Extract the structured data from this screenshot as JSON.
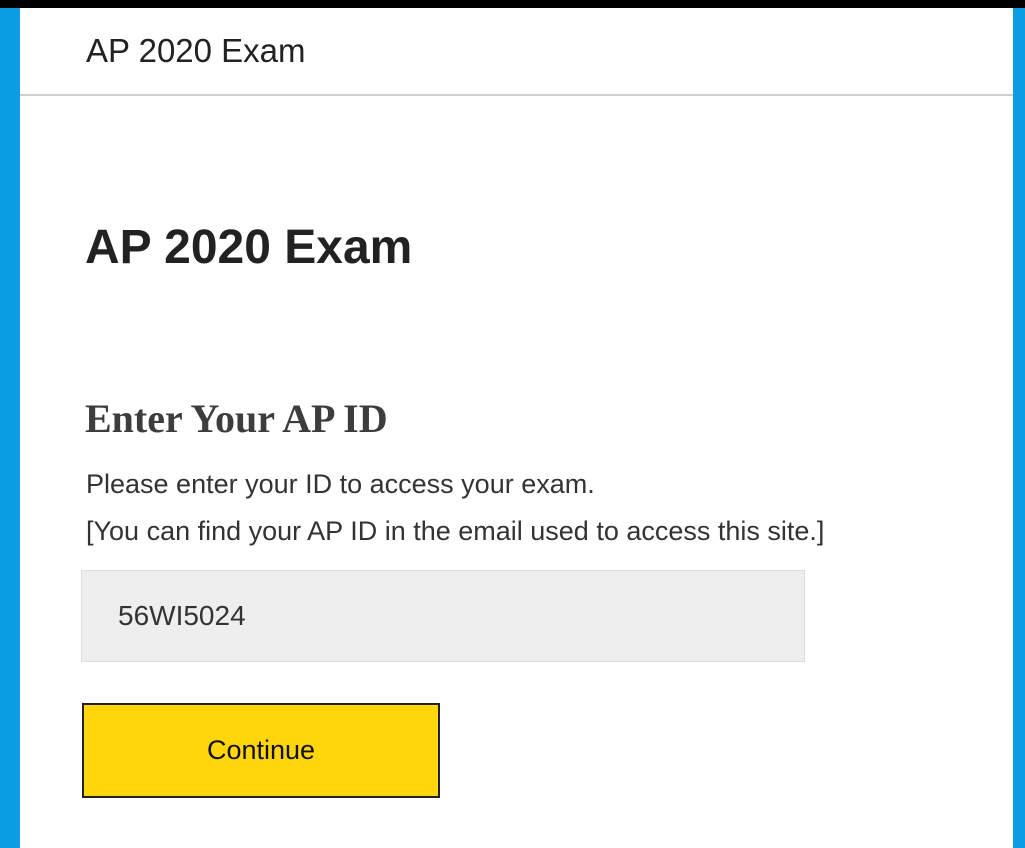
{
  "header": {
    "title": "AP 2020 Exam"
  },
  "main": {
    "title": "AP 2020 Exam",
    "section_heading": "Enter Your AP ID",
    "instruction_line_1": "Please enter your ID to access your exam.",
    "instruction_line_2": "[You can find your AP ID in the email used to access this site.]",
    "ap_id_input": {
      "value": "56WI5024",
      "placeholder": ""
    },
    "continue_label": "Continue"
  },
  "colors": {
    "frame": "#0a9de4",
    "top_bar": "#000000",
    "page_background": "#ffffff",
    "header_divider": "#cfcfcf",
    "input_background": "#eeeeee",
    "button_background": "#ffd60a",
    "button_border": "#222222",
    "heading_text": "#3d3d3d",
    "body_text": "#333333"
  }
}
